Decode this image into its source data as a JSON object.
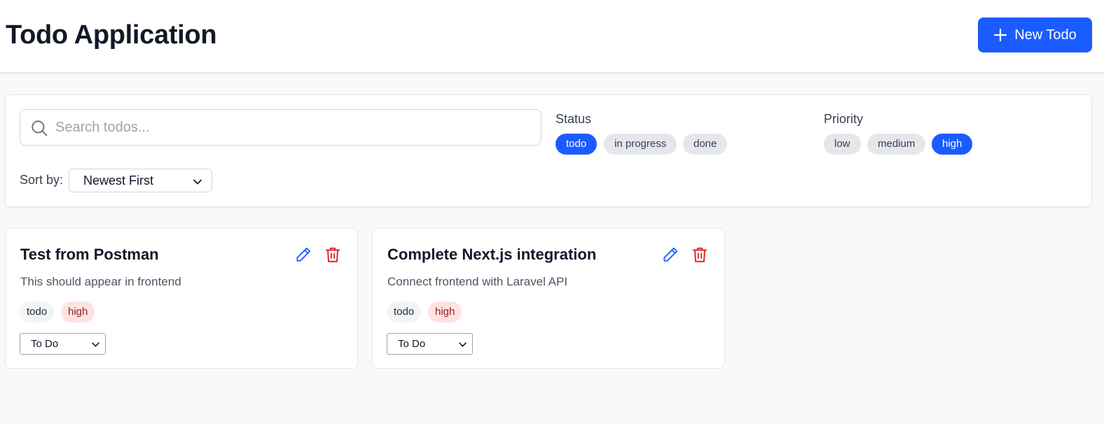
{
  "header": {
    "title": "Todo Application",
    "new_button_label": "New Todo"
  },
  "filters": {
    "search_placeholder": "Search todos...",
    "status_label": "Status",
    "status_options": [
      {
        "label": "todo",
        "active": true
      },
      {
        "label": "in progress",
        "active": false
      },
      {
        "label": "done",
        "active": false
      }
    ],
    "priority_label": "Priority",
    "priority_options": [
      {
        "label": "low",
        "active": false
      },
      {
        "label": "medium",
        "active": false
      },
      {
        "label": "high",
        "active": true
      }
    ],
    "sort_label": "Sort by:",
    "sort_value": "Newest First"
  },
  "todos": [
    {
      "title": "Test from Postman",
      "description": "This should appear in frontend",
      "status": "todo",
      "priority": "high",
      "status_select_value": "To Do"
    },
    {
      "title": "Complete Next.js integration",
      "description": "Connect frontend with Laravel API",
      "status": "todo",
      "priority": "high",
      "status_select_value": "To Do"
    }
  ],
  "colors": {
    "accent": "#1a5cff",
    "danger": "#dc2626",
    "priority_high_bg": "#fee2e2",
    "priority_high_text": "#991b1b"
  }
}
